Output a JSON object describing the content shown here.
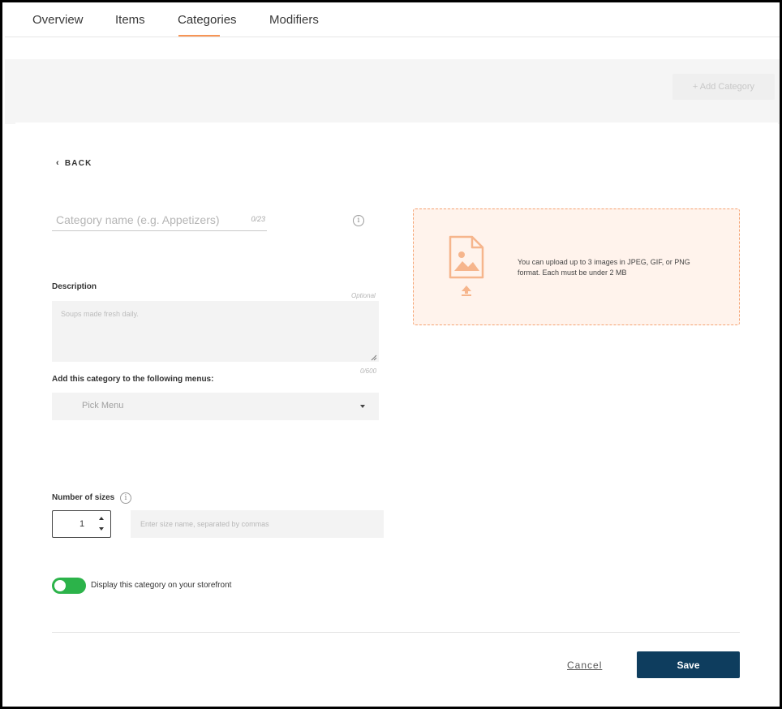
{
  "tabs": [
    {
      "label": "Overview",
      "active": false
    },
    {
      "label": "Items",
      "active": false
    },
    {
      "label": "Categories",
      "active": true
    },
    {
      "label": "Modifiers",
      "active": false
    }
  ],
  "toolbar": {
    "add_category_label": "+ Add Category"
  },
  "form": {
    "back_label": "BACK",
    "back_icon": "chevron-left-icon",
    "name": {
      "placeholder": "Category name (e.g. Appetizers)",
      "value": "",
      "counter": "0/23"
    },
    "description": {
      "label": "Description",
      "optional_label": "Optional",
      "placeholder": "Soups made fresh daily.",
      "value": "",
      "counter": "0/600"
    },
    "menus": {
      "label": "Add this category to the following menus:",
      "selected": "Pick Menu"
    },
    "sizes": {
      "label": "Number of sizes",
      "count": "1",
      "names_placeholder": "Enter size name, separated by commas"
    },
    "storefront": {
      "label": "Display this category on your storefront",
      "enabled": true
    },
    "cancel_label": "Cancel",
    "save_label": "Save"
  },
  "upload": {
    "message": "You can upload up to 3 images in JPEG, GIF, or PNG format. Each must be under 2 MB"
  },
  "colors": {
    "accent": "#f79555",
    "save_button": "#0e3d5e",
    "toggle_on": "#2cb34a",
    "upload_bg": "#fff3ec",
    "upload_border": "#f5a271"
  }
}
